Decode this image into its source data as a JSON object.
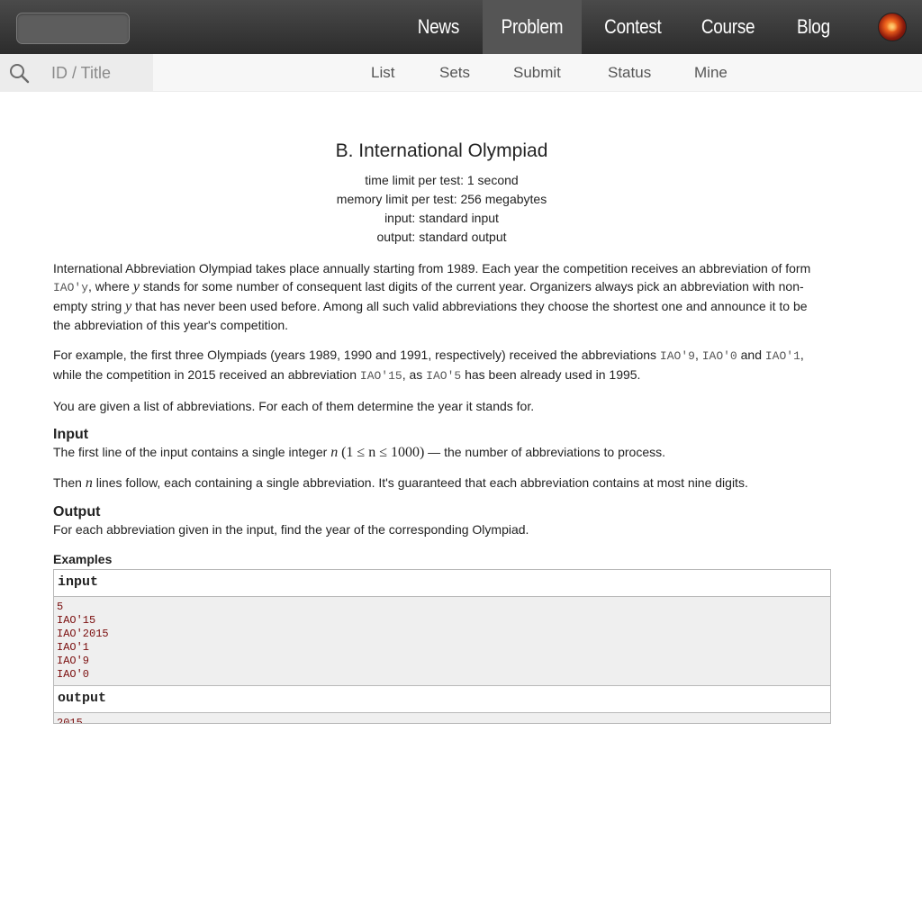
{
  "nav": {
    "items": [
      "News",
      "Problem",
      "Contest",
      "Course",
      "Blog"
    ],
    "active": "Problem"
  },
  "subnav": {
    "search_placeholder": "ID / Title",
    "items": [
      "List",
      "Sets",
      "Submit",
      "Status",
      "Mine"
    ]
  },
  "problem": {
    "title": "B. International Olympiad",
    "time_limit": "time limit per test: 1 second",
    "memory_limit": "memory limit per test: 256 megabytes",
    "input": "input: standard input",
    "output": "output: standard output"
  },
  "statement": {
    "p1a": "International Abbreviation Olympiad takes place annually starting from 1989. Each year the competition receives an abbreviation of form ",
    "p1_code": "IAO'y",
    "p1b": ", where ",
    "p1_var_y1": "y",
    "p1c": " stands for some number of consequent last digits of the current year. Organizers always pick an abbreviation with non-empty string ",
    "p1_var_y2": "y",
    "p1d": " that has never been used before. Among all such valid abbreviations they choose the shortest one and announce it to be the abbreviation of this year's competition.",
    "p2a": "For example, the first three Olympiads (years 1989, 1990 and 1991, respectively) received the abbreviations ",
    "p2_code1": "IAO'9",
    "p2_sep1": ", ",
    "p2_code2": "IAO'0",
    "p2_and": " and ",
    "p2_code3": "IAO'1",
    "p2b": ", while the competition in 2015 received an abbreviation ",
    "p2_code4": "IAO'15",
    "p2_as": ", as ",
    "p2_code5": "IAO'5",
    "p2c": " has been already used in 1995.",
    "p3": "You are given a list of abbreviations. For each of them determine the year it stands for.",
    "input_title": "Input",
    "input_a": "The first line of the input contains a single integer ",
    "input_var_n": "n",
    "input_math": "(1 ≤ n ≤ 1000)",
    "input_b": " — the number of abbreviations to process.",
    "input2_a": "Then ",
    "input2_var_n": "n",
    "input2_b": " lines follow, each containing a single abbreviation. It's guaranteed that each abbreviation contains at most nine digits.",
    "output_title": "Output",
    "output_text": "For each abbreviation given in the input, find the year of the corresponding Olympiad."
  },
  "examples": {
    "title": "Examples",
    "input_label": "input",
    "input_lines": [
      "5",
      "IAO'15",
      "IAO'2015",
      "IAO'1",
      "IAO'9",
      "IAO'0"
    ],
    "output_label": "output",
    "output_lines": [
      "2015"
    ]
  }
}
